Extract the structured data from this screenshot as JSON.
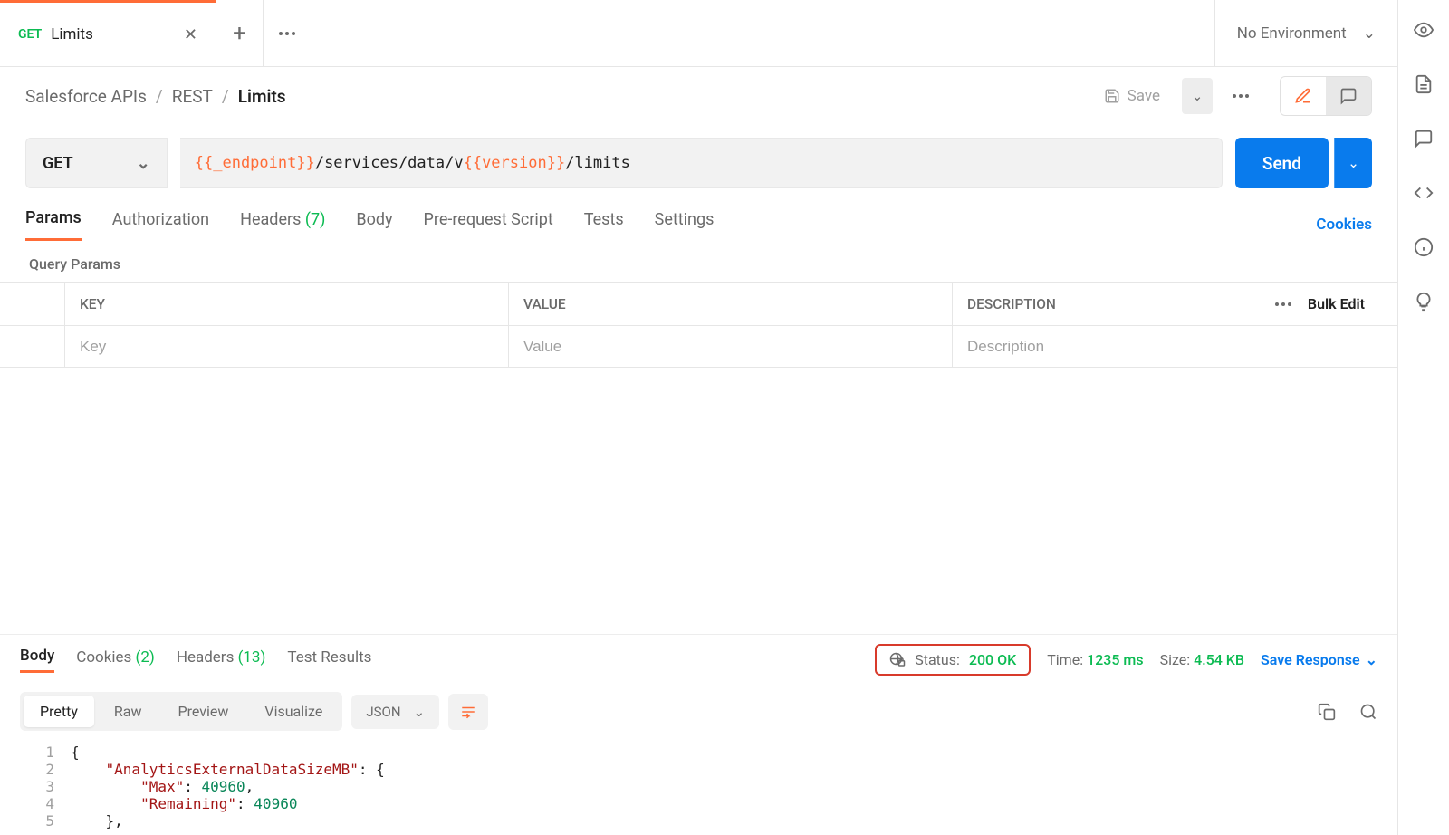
{
  "tab": {
    "method": "GET",
    "title": "Limits"
  },
  "env": {
    "label": "No Environment"
  },
  "breadcrumb": {
    "a": "Salesforce APIs",
    "b": "REST",
    "c": "Limits"
  },
  "save_label": "Save",
  "request": {
    "method": "GET",
    "url_pre": "{{_endpoint}}",
    "url_mid": "/services/data/v",
    "url_var": "{{version}}",
    "url_post": "/limits",
    "send": "Send"
  },
  "req_tabs": {
    "params": "Params",
    "auth": "Authorization",
    "headers": "Headers",
    "headers_count": "(7)",
    "body": "Body",
    "prs": "Pre-request Script",
    "tests": "Tests",
    "settings": "Settings",
    "cookies": "Cookies"
  },
  "section_title": "Query Params",
  "table": {
    "key": "KEY",
    "value": "VALUE",
    "desc": "DESCRIPTION",
    "bulk_edit": "Bulk Edit",
    "ph_key": "Key",
    "ph_value": "Value",
    "ph_desc": "Description"
  },
  "resp_tabs": {
    "body": "Body",
    "cookies": "Cookies",
    "cookies_cnt": "(2)",
    "headers": "Headers",
    "headers_cnt": "(13)",
    "tests": "Test Results"
  },
  "resp_meta": {
    "status_lbl": "Status:",
    "status_val": "200 OK",
    "time_lbl": "Time:",
    "time_val": "1235 ms",
    "size_lbl": "Size:",
    "size_val": "4.54 KB",
    "save": "Save Response"
  },
  "viewer": {
    "pretty": "Pretty",
    "raw": "Raw",
    "preview": "Preview",
    "visualize": "Visualize",
    "format": "JSON"
  },
  "code": {
    "l1": "{",
    "l2_key": "\"AnalyticsExternalDataSizeMB\"",
    "l2_sep": ": {",
    "l3_key": "\"Max\"",
    "l3_val": "40960",
    "l3_sep": ": ",
    "l3_end": ",",
    "l4_key": "\"Remaining\"",
    "l4_sep": ": ",
    "l4_val": "40960",
    "l5": "},"
  }
}
